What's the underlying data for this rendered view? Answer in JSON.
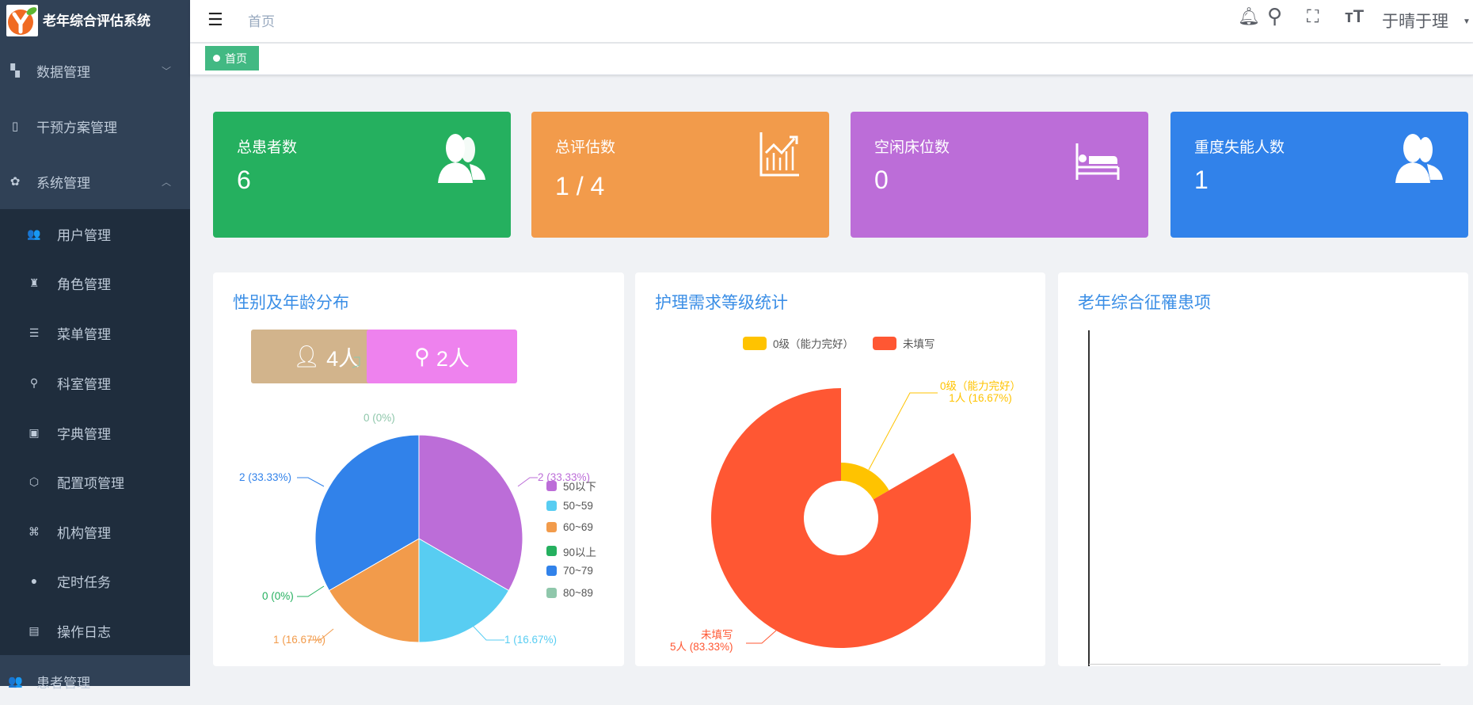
{
  "app": {
    "title": "老年综合评估系统"
  },
  "sidebar": {
    "items": [
      {
        "label": "数据管理",
        "icon": "dashboard-icon",
        "expanded": false
      },
      {
        "label": "干预方案管理",
        "icon": "book-icon"
      },
      {
        "label": "系统管理",
        "icon": "gear-icon",
        "expanded": true
      },
      {
        "label": "患者管理",
        "icon": "users-icon"
      }
    ],
    "submenu": [
      {
        "label": "用户管理",
        "icon": "user-group-icon"
      },
      {
        "label": "角色管理",
        "icon": "role-icon"
      },
      {
        "label": "菜单管理",
        "icon": "menu-list-icon"
      },
      {
        "label": "科室管理",
        "icon": "tree-icon"
      },
      {
        "label": "字典管理",
        "icon": "dictionary-icon"
      },
      {
        "label": "配置项管理",
        "icon": "cube-icon"
      },
      {
        "label": "机构管理",
        "icon": "grid-icon"
      },
      {
        "label": "定时任务",
        "icon": "timer-icon"
      },
      {
        "label": "操作日志",
        "icon": "log-icon"
      }
    ]
  },
  "header": {
    "breadcrumb": "首页",
    "user": "于晴于理"
  },
  "tags": [
    {
      "label": "首页"
    }
  ],
  "cards": [
    {
      "title": "总患者数",
      "value": "6",
      "color": "#25b05f",
      "icon": "peoples-icon"
    },
    {
      "title": "总评估数",
      "value": "1 / 4",
      "color": "#f29b4b",
      "icon": "chart-growth-icon"
    },
    {
      "title": "空闲床位数",
      "value": "0",
      "color": "#bc6dd8",
      "icon": "bed-icon"
    },
    {
      "title": "重度失能人数",
      "value": "1",
      "color": "#3182ea",
      "icon": "peoples-icon"
    }
  ],
  "panels": {
    "gender_age": {
      "title": "性别及年龄分布",
      "male": "4人",
      "female": "2人",
      "male_color": "#d2b48c",
      "female_color": "#ee82ee"
    },
    "care": {
      "title": "护理需求等级统计"
    },
    "syndrome": {
      "title": "老年综合征罹患项"
    }
  },
  "chart_data": [
    {
      "type": "pie",
      "name": "age-distribution",
      "series": [
        {
          "name": "50以下",
          "value": 2,
          "label": "2 (33.33%)",
          "color": "#bc6dd8"
        },
        {
          "name": "50~59",
          "value": 1,
          "label": "1 (16.67%)",
          "color": "#58cdf2"
        },
        {
          "name": "60~69",
          "value": 1,
          "label": "1 (16.67%)",
          "color": "#f29b4b"
        },
        {
          "name": "90以上",
          "value": 0,
          "label": "0 (0%)",
          "color": "#25b05f"
        },
        {
          "name": "70~79",
          "value": 2,
          "label": "2 (33.33%)",
          "color": "#3182ea"
        },
        {
          "name": "80~89",
          "value": 0,
          "label": "0 (0%)",
          "color": "#8fc7ab"
        }
      ],
      "legend": "right"
    },
    {
      "type": "pie",
      "name": "care-level",
      "roseType": "radius",
      "series": [
        {
          "name": "0级（能力完好）",
          "value": 1,
          "label1": "0级（能力完好）",
          "label2": "1人 (16.67%)",
          "color": "#ffc300"
        },
        {
          "name": "未填写",
          "value": 5,
          "label1": "未填写",
          "label2": "5人 (83.33%)",
          "color": "#ff5733"
        }
      ],
      "legend": "top"
    },
    {
      "type": "bar",
      "name": "syndrome",
      "categories": [],
      "values": []
    }
  ]
}
